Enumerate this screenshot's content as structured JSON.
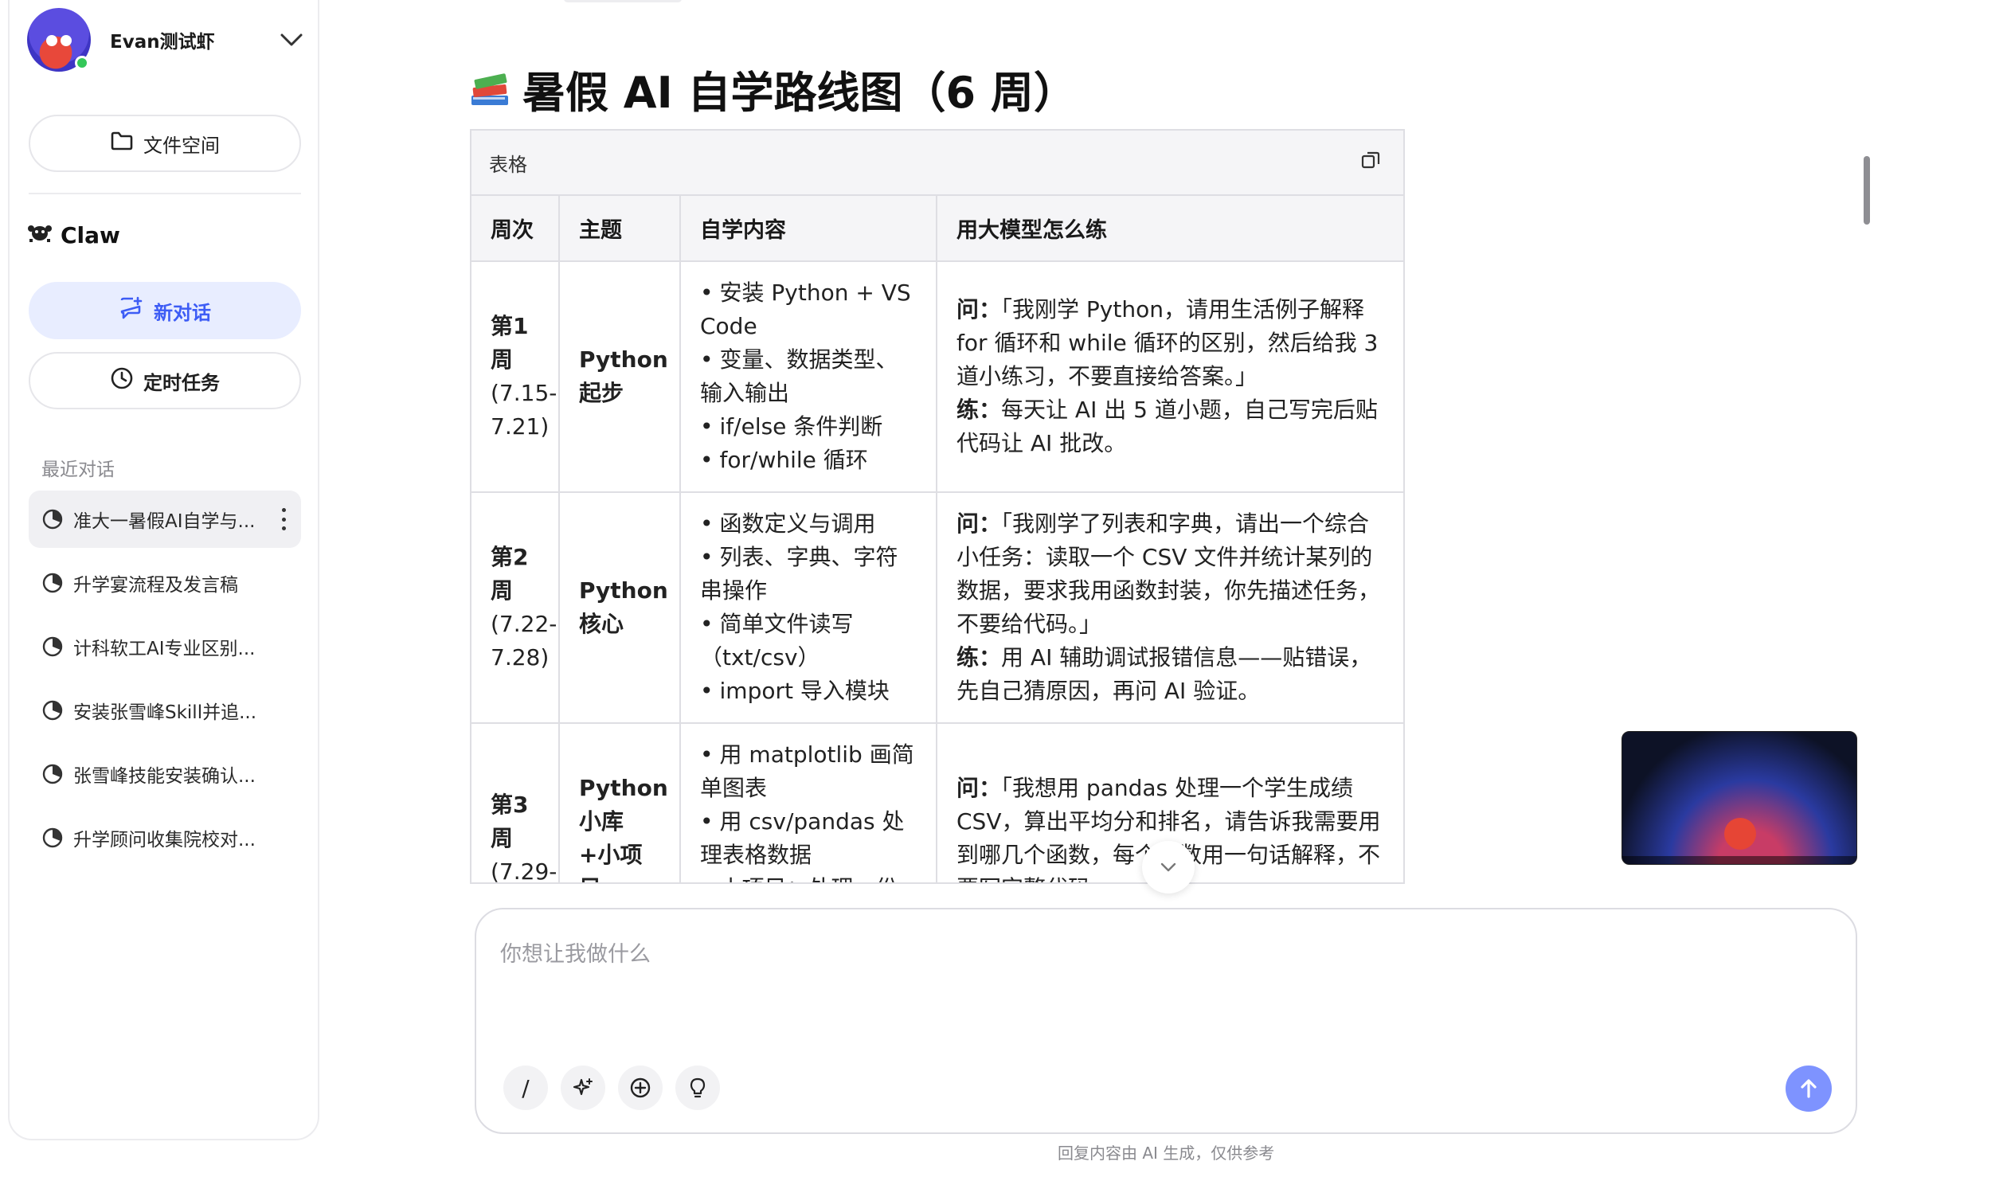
{
  "sidebar": {
    "user_name": "Evan测试虾",
    "files_label": "文件空间",
    "section_title": "Claw",
    "new_chat_label": "新对话",
    "scheduled_label": "定时任务",
    "recent_label": "最近对话",
    "recent_items": [
      {
        "label": "准大一暑假AI自学与..."
      },
      {
        "label": "升学宴流程及发言稿"
      },
      {
        "label": "计科软工AI专业区别..."
      },
      {
        "label": "安装张雪峰Skill并追..."
      },
      {
        "label": "张雪峰技能安装确认..."
      },
      {
        "label": "升学顾问收集院校对..."
      }
    ]
  },
  "main": {
    "heading": "暑假 AI 自学路线图（6 周）",
    "table_label": "表格",
    "columns": [
      "周次",
      "主题",
      "自学内容",
      "用大模型怎么练"
    ],
    "rows": [
      {
        "week": "第1周",
        "dates": "(7.15-7.21)",
        "topic": "Python起步",
        "content": [
          "安装 Python + VS Code",
          "变量、数据类型、输入输出",
          "if/else 条件判断",
          "for/while 循环"
        ],
        "ask_label": "问：",
        "ask": "「我刚学 Python，请用生活例子解释 for 循环和 while 循环的区别，然后给我 3 道小练习，不要直接给答案。」",
        "practice_label": "练：",
        "practice": "每天让 AI 出 5 道小题，自己写完后贴代码让 AI 批改。"
      },
      {
        "week": "第2周",
        "dates": "(7.22-7.28)",
        "topic": "Python核心",
        "content": [
          "函数定义与调用",
          "列表、字典、字符串操作",
          "简单文件读写（txt/csv）",
          "import 导入模块"
        ],
        "ask_label": "问：",
        "ask": "「我刚学了列表和字典，请出一个综合小任务：读取一个 CSV 文件并统计某列的数据，要求我用函数封装，你先描述任务，不要给代码。」",
        "practice_label": "练：",
        "practice": "用 AI 辅助调试报错信息——贴错误，先自己猜原因，再问 AI 验证。"
      },
      {
        "week": "第3周",
        "dates": "(7.29-",
        "topic": "Python小库 +小项目",
        "content": [
          "用 matplotlib 画简单图表",
          "用 csv/pandas 处理表格数据",
          "小项目：处理一份真"
        ],
        "ask_label": "问：",
        "ask": "「我想用 pandas 处理一个学生成绩 CSV，算出平均分和排名，请告诉我需要用到哪几个函数，每个函数用一句话解释，不要写完整代码。」",
        "practice_label": "",
        "practice": ""
      }
    ]
  },
  "composer": {
    "placeholder": "你想让我做什么",
    "tool_slash": "/"
  },
  "footer_note": "回复内容由 AI 生成，仅供参考",
  "colors": {
    "accent": "#3d5cf5",
    "accent_bg": "#e8edff",
    "send_button": "#7e93ff"
  }
}
